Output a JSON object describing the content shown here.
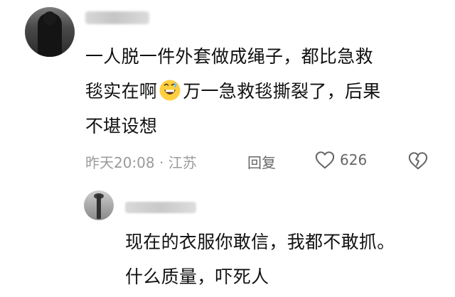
{
  "main_comment": {
    "text_lines": [
      "一人脱一件外套做成绳子，都比急救",
      "毯实在啊😅万一急救毯撕裂了，后果",
      "不堪设想"
    ],
    "line_1": "一人脱一件外套做成绳子，都比急救",
    "line_2_before_emoji": "毯实在啊",
    "line_2_after_emoji": "万一急救毯撕裂了，后果",
    "line_3": "不堪设想",
    "date_location": "昨天20:08 · 江苏",
    "reply_label": "回复",
    "likes": "626",
    "emoji_icon": "grinning-sweat-icon"
  },
  "reply_comment": {
    "line_1": "现在的衣服你敢信，我都不敢抓。",
    "line_2": "什么质量，吓死人"
  },
  "colors": {
    "text": "#111111",
    "meta": "#9a9a9a",
    "reply_btn": "#666666",
    "heart": "#666666"
  }
}
